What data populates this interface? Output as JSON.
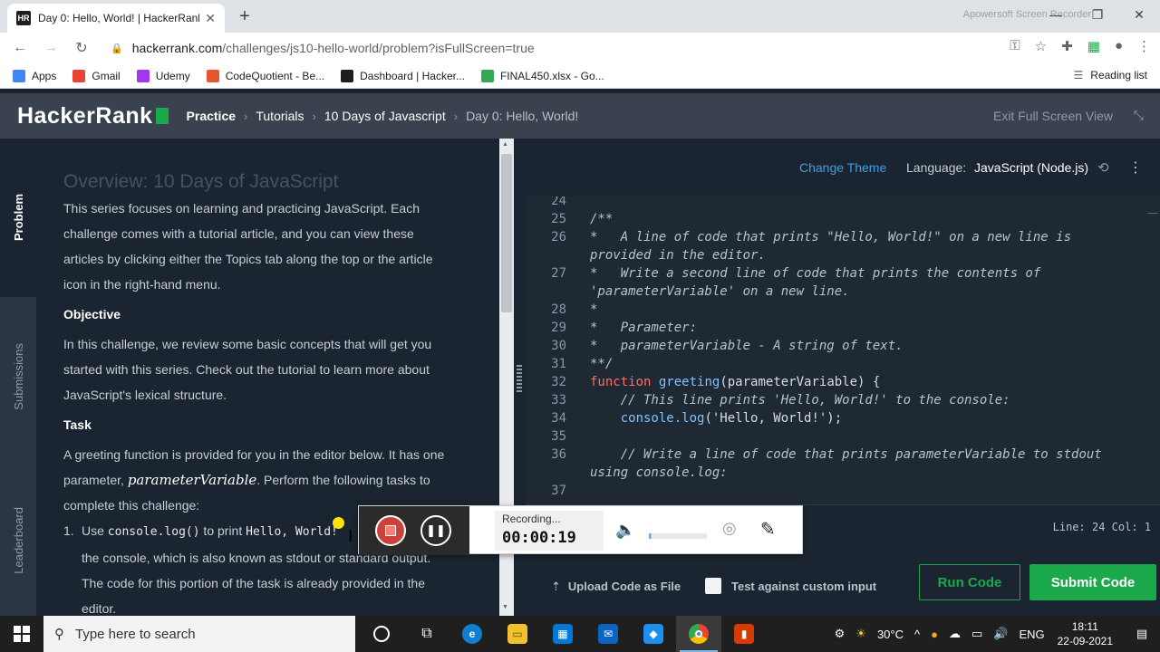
{
  "browser": {
    "tab_title": "Day 0: Hello, World! | HackerRank",
    "favicon": "HR",
    "new_tab": "+",
    "url_host": "hackerrank.com",
    "url_path": "/challenges/js10-hello-world/problem?isFullScreen=true",
    "reading_list": "Reading list",
    "bookmarks": [
      {
        "label": "Apps",
        "icon": "apps-grid-icon",
        "color": "#4285f4"
      },
      {
        "label": "Gmail",
        "icon": "gmail-icon",
        "color": "#ea4335"
      },
      {
        "label": "Udemy",
        "icon": "udemy-icon",
        "color": "#a435f0"
      },
      {
        "label": "CodeQuotient - Be...",
        "icon": "codequotient-icon",
        "color": "#e8542c"
      },
      {
        "label": "Dashboard | Hacker...",
        "icon": "hackerrank-icon",
        "color": "#1d1d1d"
      },
      {
        "label": "FINAL450.xlsx - Go...",
        "icon": "google-drive-icon",
        "color": "#34a853"
      }
    ]
  },
  "header": {
    "logo": "HackerRank",
    "breadcrumbs": [
      "Practice",
      "Tutorials",
      "10 Days of Javascript",
      "Day 0: Hello, World!"
    ],
    "exit_fullscreen": "Exit Full Screen View"
  },
  "sidetabs": [
    "Problem",
    "Submissions",
    "Leaderboard"
  ],
  "problem": {
    "title": "Overview: 10 Days of JavaScript",
    "intro": [
      "This series focuses on learning and practicing JavaScript. Each",
      "challenge comes with a tutorial article, and you can view these",
      "articles by clicking either the Topics tab along the top or the article",
      "icon in the right-hand menu."
    ],
    "objective_heading": "Objective",
    "objective": [
      "In this challenge, we review some basic concepts that will get you",
      "started with this series. Check out the tutorial to learn more about",
      "JavaScript's lexical structure."
    ],
    "task_heading": "Task",
    "task_line1": "A greeting function is provided for you in the editor below. It has one",
    "task_line2_pre": "parameter, ",
    "task_param": "parameterVariable",
    "task_line2_post": ". Perform the following tasks to",
    "task_line3": "complete this challenge:",
    "list_num": "1.",
    "list_pre": "Use ",
    "list_code1": "console.log()",
    "list_mid": " to print ",
    "list_code2": "Hello, World!",
    "list_line2": "the console, which is also known as stdout or standard output.",
    "list_line3": "The code for this portion of the task is already provided in the",
    "list_line4": "editor."
  },
  "editor": {
    "change_theme": "Change Theme",
    "language_label": "Language:",
    "language": "JavaScript (Node.js)",
    "line_col": "Line: 24 Col: 1",
    "lines": [
      {
        "n": "24",
        "text": ""
      },
      {
        "n": "25",
        "text": "/**"
      },
      {
        "n": "26",
        "text": "*   A line of code that prints \"Hello, World!\" on a new line is"
      },
      {
        "n": "",
        "text": "provided in the editor."
      },
      {
        "n": "27",
        "text": "*   Write a second line of code that prints the contents of"
      },
      {
        "n": "",
        "text": "'parameterVariable' on a new line."
      },
      {
        "n": "28",
        "text": "*"
      },
      {
        "n": "29",
        "text": "*   Parameter:"
      },
      {
        "n": "30",
        "text": "*   parameterVariable - A string of text."
      },
      {
        "n": "31",
        "text": "**/"
      },
      {
        "n": "32",
        "kw": "function",
        "fn": "greeting",
        "rest": "(parameterVariable) {"
      },
      {
        "n": "33",
        "text": "    // This line prints 'Hello, World!' to the console:"
      },
      {
        "n": "34",
        "fn": "    console.log",
        "rest": "('Hello, World!');"
      },
      {
        "n": "35",
        "text": ""
      },
      {
        "n": "36",
        "text": "    // Write a line of code that prints parameterVariable to stdout"
      },
      {
        "n": "",
        "text": "using console.log:"
      },
      {
        "n": "37",
        "text": ""
      }
    ],
    "upload": "Upload Code as File",
    "custom_input": "Test against custom input",
    "run": "Run Code",
    "submit": "Submit Code"
  },
  "recorder": {
    "state": "Recording...",
    "time": "00:00:19",
    "watermark": "Apowersoft Screen Recorder"
  },
  "taskbar": {
    "search_placeholder": "Type here to search",
    "weather": "30°C",
    "lang": "ENG",
    "time": "18:11",
    "date": "22-09-2021"
  }
}
